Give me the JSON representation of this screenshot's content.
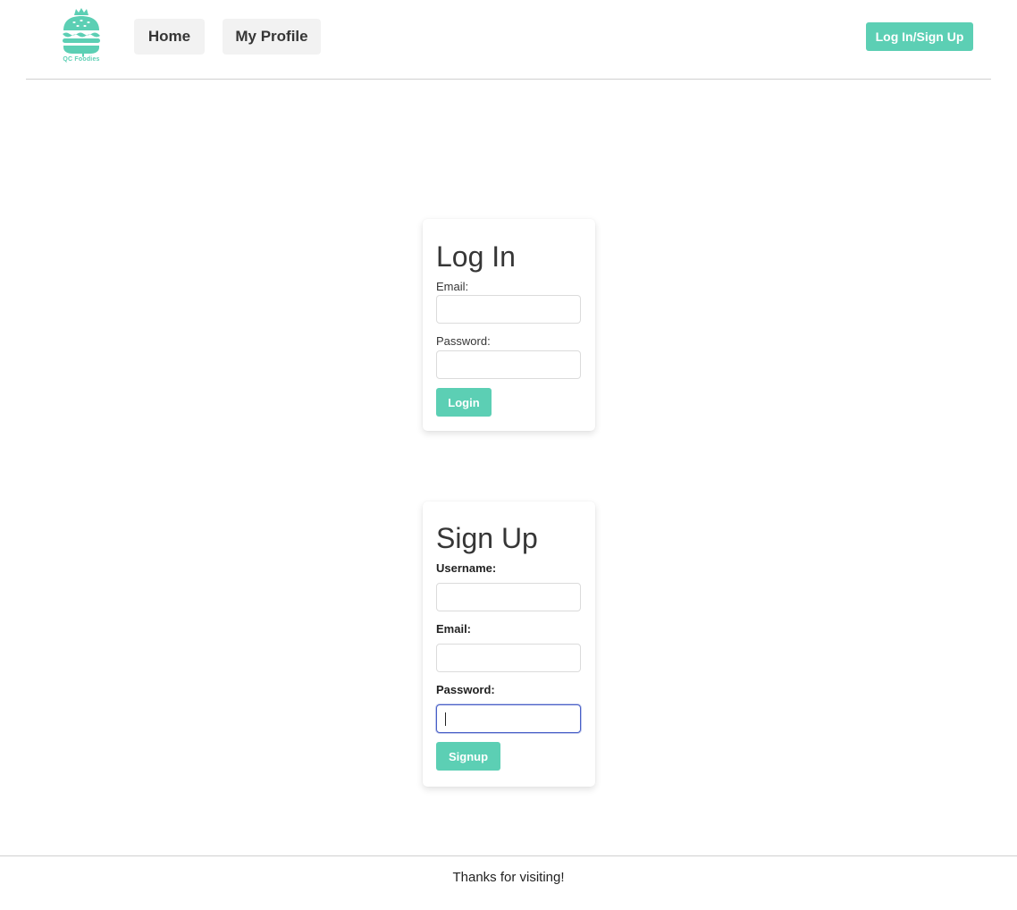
{
  "brand": {
    "name": "QC Foodies",
    "color": "#5ccfb4"
  },
  "nav": {
    "home": "Home",
    "profile": "My Profile",
    "auth_button": "Log In/Sign Up"
  },
  "login": {
    "title": "Log In",
    "email_label": "Email:",
    "email_value": "",
    "password_label": "Password:",
    "password_value": "",
    "submit": "Login"
  },
  "signup": {
    "title": "Sign Up",
    "username_label": "Username:",
    "username_value": "",
    "email_label": "Email:",
    "email_value": "",
    "password_label": "Password:",
    "password_value": "",
    "submit": "Signup"
  },
  "footer": {
    "text": "Thanks for visiting!"
  }
}
